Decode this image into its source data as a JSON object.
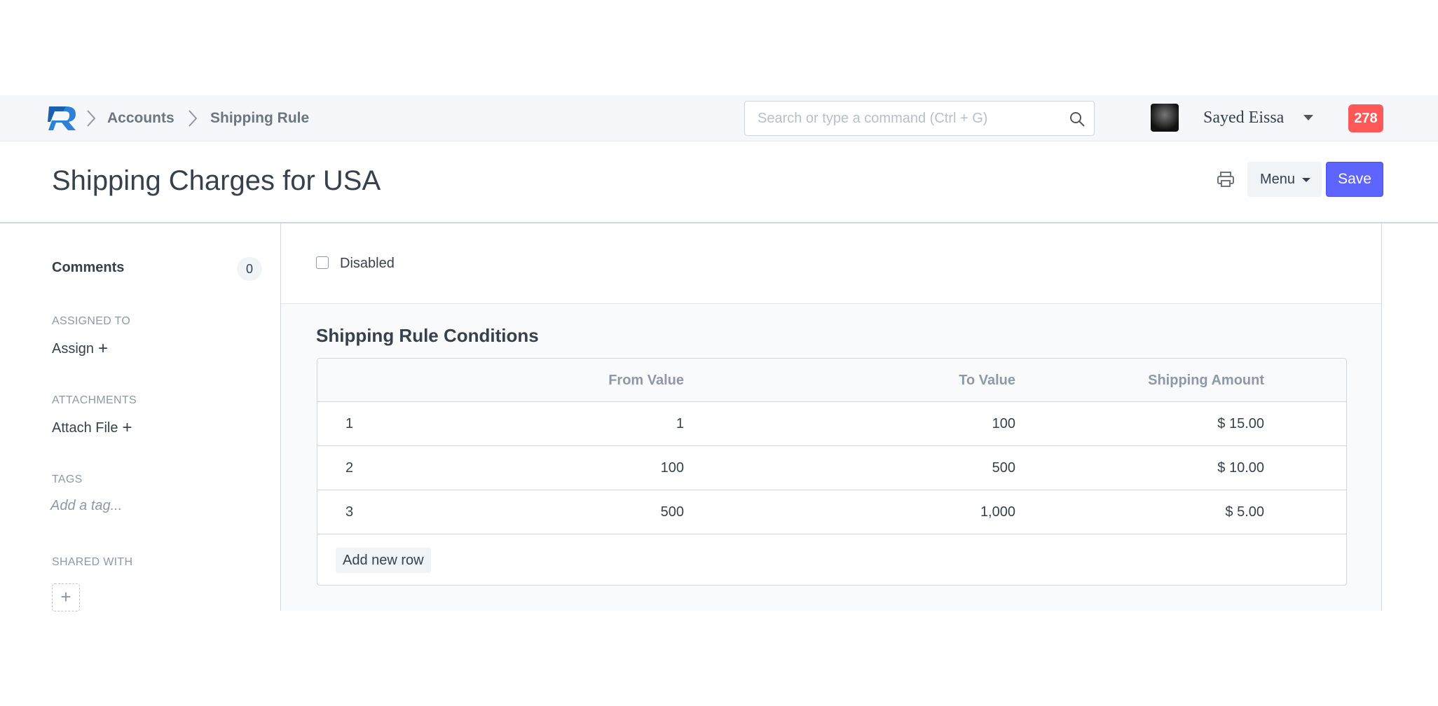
{
  "navbar": {
    "logo": "R-logo-icon",
    "breadcrumbs": [
      "Accounts",
      "Shipping Rule"
    ],
    "search": {
      "placeholder": "Search or type a command (Ctrl + G)"
    },
    "user": {
      "name": "Sayed Eissa"
    },
    "notifications": {
      "count": "278"
    }
  },
  "page": {
    "title": "Shipping Charges for USA",
    "menu_label": "Menu",
    "save_label": "Save"
  },
  "sidebar": {
    "comments_label": "Comments",
    "comments_count": "0",
    "assigned_to_label": "ASSIGNED TO",
    "assign_link": "Assign",
    "attachments_label": "ATTACHMENTS",
    "attach_link": "Attach File",
    "tags_label": "TAGS",
    "tag_placeholder": "Add a tag...",
    "shared_with_label": "SHARED WITH"
  },
  "form": {
    "disabled_label": "Disabled",
    "disabled_checked": false,
    "section_title": "Shipping Rule Conditions",
    "table": {
      "columns": [
        "From Value",
        "To Value",
        "Shipping Amount"
      ],
      "rows": [
        {
          "idx": "1",
          "from": "1",
          "to": "100",
          "amount": "$ 15.00"
        },
        {
          "idx": "2",
          "from": "100",
          "to": "500",
          "amount": "$ 10.00"
        },
        {
          "idx": "3",
          "from": "500",
          "to": "1,000",
          "amount": "$ 5.00"
        }
      ],
      "add_row_label": "Add new row"
    }
  },
  "colors": {
    "primary": "#5e64ff",
    "notification": "#ff5858",
    "text": "#36414c",
    "muted": "#8d99a6"
  }
}
